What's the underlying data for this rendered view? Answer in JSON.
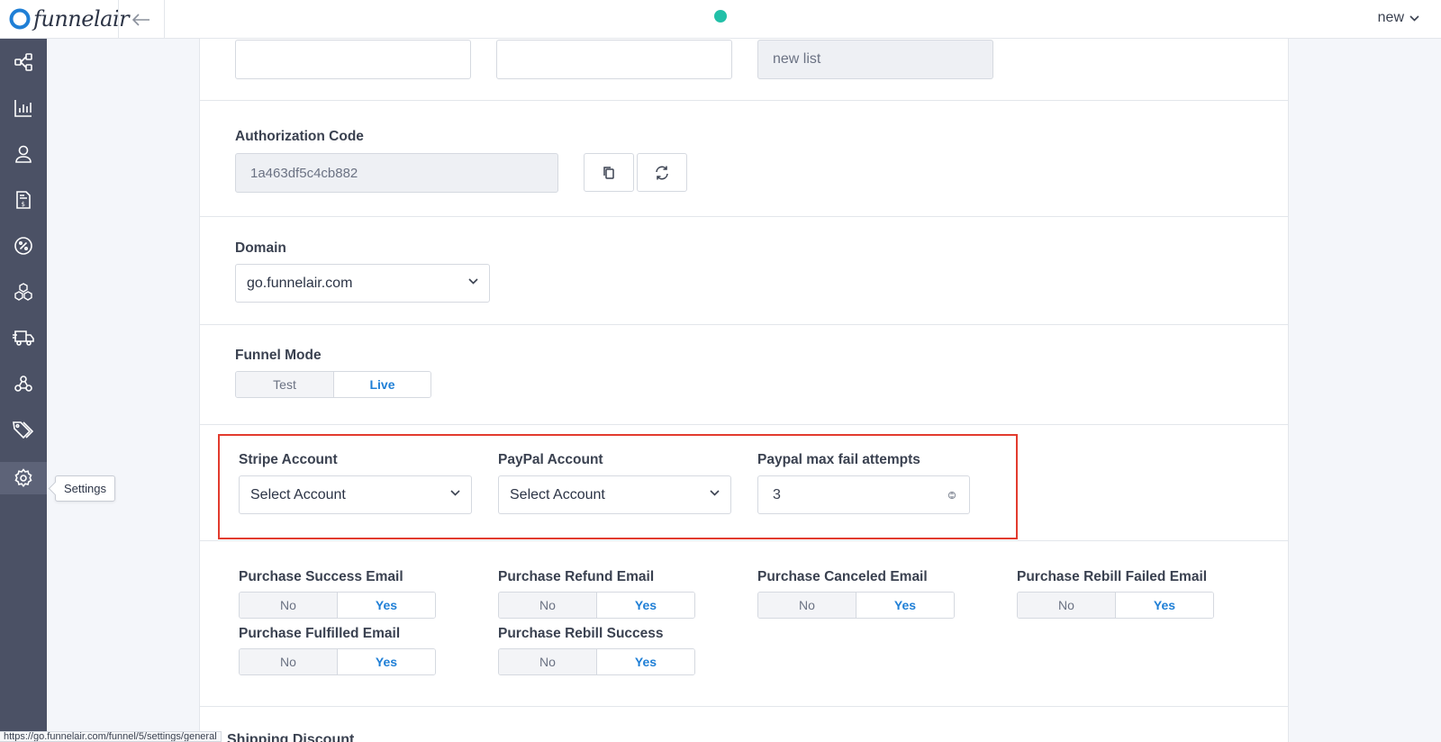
{
  "app": {
    "logo_text": "funnelair",
    "user_label": "new"
  },
  "sidebar": {
    "tooltip": "Settings"
  },
  "top_fields": {
    "list_name_value": "new list"
  },
  "authorization": {
    "label": "Authorization Code",
    "value": "1a463df5c4cb882"
  },
  "domain": {
    "label": "Domain",
    "value": "go.funnelair.com"
  },
  "funnel_mode": {
    "label": "Funnel Mode",
    "options": [
      "Test",
      "Live"
    ],
    "selected": "Live"
  },
  "payments": {
    "stripe_label": "Stripe Account",
    "stripe_value": "Select Account",
    "paypal_label": "PayPal Account",
    "paypal_value": "Select Account",
    "max_fail_label": "Paypal max fail attempts",
    "max_fail_value": "3"
  },
  "emails": [
    {
      "label": "Purchase Success Email",
      "no": "No",
      "yes": "Yes",
      "selected": "Yes"
    },
    {
      "label": "Purchase Refund Email",
      "no": "No",
      "yes": "Yes",
      "selected": "Yes"
    },
    {
      "label": "Purchase Canceled Email",
      "no": "No",
      "yes": "Yes",
      "selected": "Yes"
    },
    {
      "label": "Purchase Rebill Failed Email",
      "no": "No",
      "yes": "Yes",
      "selected": "Yes"
    },
    {
      "label": "Purchase Fulfilled Email",
      "no": "No",
      "yes": "Yes",
      "selected": "Yes"
    },
    {
      "label": "Purchase Rebill Success",
      "no": "No",
      "yes": "Yes",
      "selected": "Yes"
    }
  ],
  "next_section": {
    "title": "Shipping Discount"
  },
  "status_bar": {
    "url": "https://go.funnelair.com/funnel/5/settings/general"
  },
  "colors": {
    "sidebar": "#4b5165",
    "accent": "#1f7fd6",
    "status_dot": "#22c0a8",
    "highlight": "#e23b2e"
  }
}
